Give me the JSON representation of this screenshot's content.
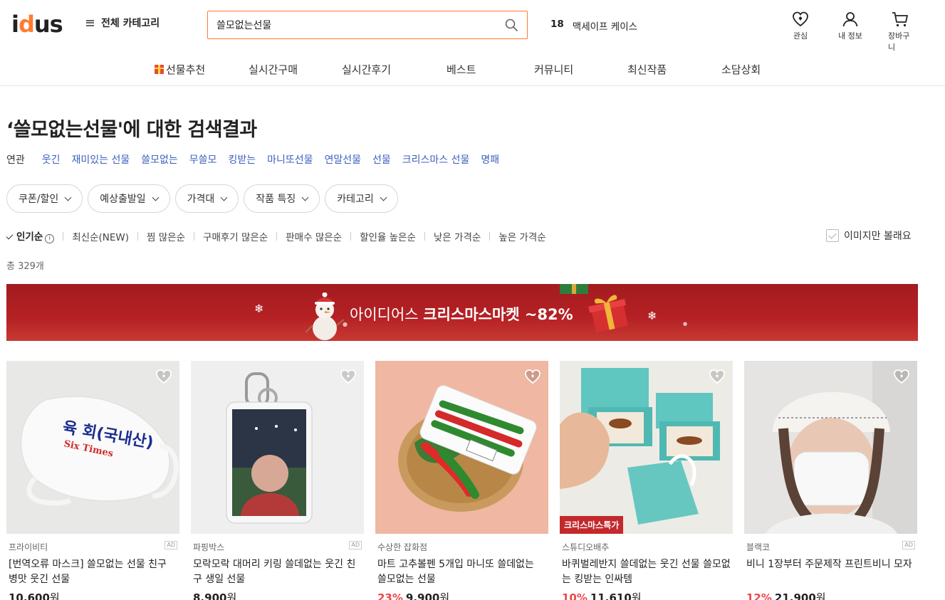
{
  "header": {
    "logo_text": "idus",
    "category_label": "전체 카테고리",
    "search_value": "쓸모없는선물",
    "trending_rank": "18",
    "trending_term": "맥세이프 케이스",
    "icons": [
      {
        "name": "heart-icon",
        "label": "관심"
      },
      {
        "name": "user-icon",
        "label": "내 정보"
      },
      {
        "name": "cart-icon",
        "label": "장바구니"
      }
    ]
  },
  "nav": [
    "선물추천",
    "실시간구매",
    "실시간후기",
    "베스트",
    "커뮤니티",
    "최신작품",
    "소담상회"
  ],
  "results": {
    "title": "‘쓸모없는선물'에 대한 검색결과",
    "related_label": "연관",
    "related_tags": [
      "웃긴",
      "재미있는 선물",
      "쓸모없는",
      "무쓸모",
      "킹받는",
      "마니또선물",
      "연말선물",
      "선물",
      "크리스마스 선물",
      "명패"
    ],
    "filters": [
      "쿠폰/할인",
      "예상출발일",
      "가격대",
      "작품 특징",
      "카테고리"
    ],
    "sorts": [
      "인기순",
      "최신순(NEW)",
      "찜 많은순",
      "구매후기 많은순",
      "판매수 많은순",
      "할인율 높은순",
      "낮은 가격순",
      "높은 가격순"
    ],
    "active_sort": "인기순",
    "image_only_label": "이미지만 볼래요",
    "total": "총 329개"
  },
  "banner": {
    "text_normal": "아이디어스 ",
    "text_bold": "크리스마스마켓 ~82%"
  },
  "products": [
    {
      "shop": "프라이비티",
      "ad": "AD",
      "name": "[번역오류 마스크] 쓸모없는 선물 친구 병맛 웃긴 선물",
      "discount": "",
      "price": "10,600",
      "won": "원",
      "badge": "",
      "mask_text_1": "육 회(국내산)",
      "mask_text_2": "Six Times"
    },
    {
      "shop": "파핑박스",
      "ad": "AD",
      "name": "모락모락 대머리 키링 쓸데없는 웃긴 친구 생일 선물",
      "discount": "",
      "price": "8,900",
      "won": "원",
      "badge": ""
    },
    {
      "shop": "수상한 잡화점",
      "ad": "",
      "name": "마트 고추볼펜 5개입 마니또 쓸데없는 쓸모없는 선물",
      "discount": "23%",
      "price": "9,900",
      "won": "원",
      "badge": ""
    },
    {
      "shop": "스튜디오배추",
      "ad": "",
      "name": "바퀴벌레반지 쓸데없는 웃긴 선물 쓸모없는 킹받는 인싸템",
      "discount": "10%",
      "price": "11,610",
      "won": "원",
      "badge": "크리스마스특가"
    },
    {
      "shop": "블랙코",
      "ad": "AD",
      "name": "비니 1장부터 주문제작 프린트비니 모자",
      "discount": "12%",
      "price": "21,900",
      "won": "원",
      "badge": ""
    }
  ],
  "colors": {
    "accent": "#ff7b30",
    "link": "#3b5fbe",
    "discount": "#f1444a",
    "banner": "#b52125"
  }
}
